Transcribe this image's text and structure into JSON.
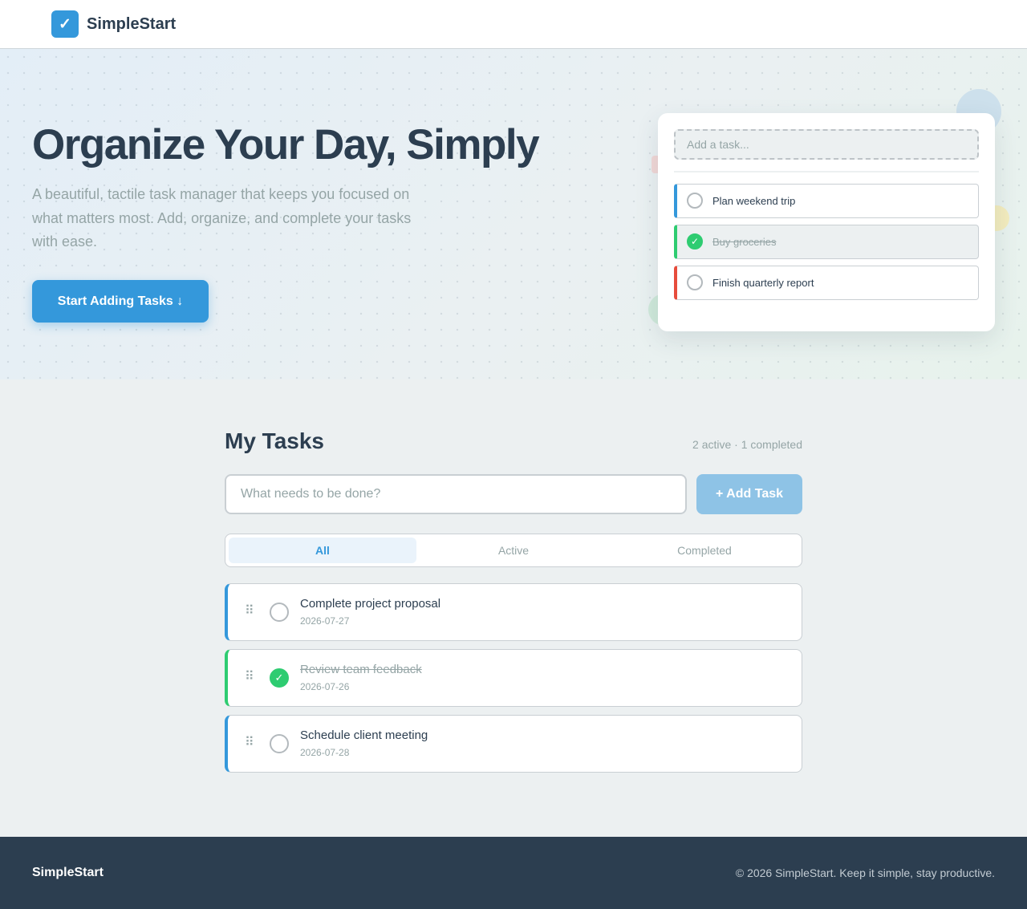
{
  "header": {
    "logo_icon": "checkmark-icon",
    "logo_glyph": "✓",
    "brand": "SimpleStart"
  },
  "hero": {
    "title": "Organize Your Day, Simply",
    "subtitle": "A beautiful, tactile task manager that keeps you focused on what matters most. Add, organize, and complete your tasks with ease.",
    "cta_label": "Start Adding Tasks ↓",
    "preview": {
      "input_placeholder": "Add a task...",
      "items": [
        {
          "label": "Plan weekend trip",
          "done": false,
          "accent": "#3498db"
        },
        {
          "label": "Buy groceries",
          "done": true,
          "accent": "#2ecc71",
          "check_glyph": "✓"
        },
        {
          "label": "Finish quarterly report",
          "done": false,
          "accent": "#e74c3c"
        }
      ]
    }
  },
  "tasks_section": {
    "title": "My Tasks",
    "counts": "2 active · 1 completed",
    "input_placeholder": "What needs to be done?",
    "add_label": "+ Add Task",
    "filters": [
      {
        "label": "All",
        "active": true
      },
      {
        "label": "Active",
        "active": false
      },
      {
        "label": "Completed",
        "active": false
      }
    ],
    "drag_glyph": "⠿",
    "check_glyph": "✓",
    "tasks": [
      {
        "title": "Complete project proposal",
        "date": "2026-07-27",
        "done": false
      },
      {
        "title": "Review team feedback",
        "date": "2026-07-26",
        "done": true
      },
      {
        "title": "Schedule client meeting",
        "date": "2026-07-28",
        "done": false
      }
    ]
  },
  "footer": {
    "brand": "SimpleStart",
    "copyright": "© 2026 SimpleStart. Keep it simple, stay productive."
  },
  "colors": {
    "primary": "#3498db",
    "success": "#2ecc71",
    "danger": "#e74c3c",
    "dark": "#2c3e50",
    "muted": "#95a5a6",
    "background": "#ecf0f1"
  }
}
